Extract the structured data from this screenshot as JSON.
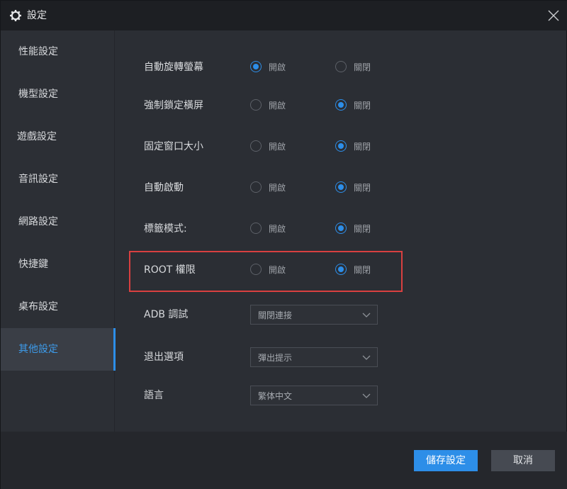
{
  "window": {
    "title": "設定"
  },
  "sidebar": {
    "items": [
      {
        "label": "性能設定"
      },
      {
        "label": "機型設定"
      },
      {
        "label": "遊戲設定"
      },
      {
        "label": "音訊設定"
      },
      {
        "label": "網路設定"
      },
      {
        "label": "快捷鍵"
      },
      {
        "label": "桌布設定"
      },
      {
        "label": "其他設定"
      }
    ],
    "active_index": 7
  },
  "settings": {
    "option_on": "開啟",
    "option_off": "關閉",
    "rows": [
      {
        "label": "自動旋轉螢幕",
        "selected": "on"
      },
      {
        "label": "強制鎖定橫屏",
        "selected": "off"
      },
      {
        "label": "固定窗口大小",
        "selected": "off"
      },
      {
        "label": "自動啟動",
        "selected": "off"
      },
      {
        "label": "標籤模式:",
        "selected": "off"
      },
      {
        "label": "ROOT 權限",
        "selected": "off"
      }
    ],
    "selects": [
      {
        "label": "ADB 調試",
        "value": "關閉連接"
      },
      {
        "label": "退出選項",
        "value": "彈出提示"
      },
      {
        "label": "語言",
        "value": "繁体中文"
      }
    ]
  },
  "footer": {
    "save_label": "儲存設定",
    "cancel_label": "取消"
  },
  "colors": {
    "accent": "#2d8ee8",
    "highlight_border": "#d94040",
    "background": "#2b2e34",
    "titlebar": "#1d1f23"
  }
}
